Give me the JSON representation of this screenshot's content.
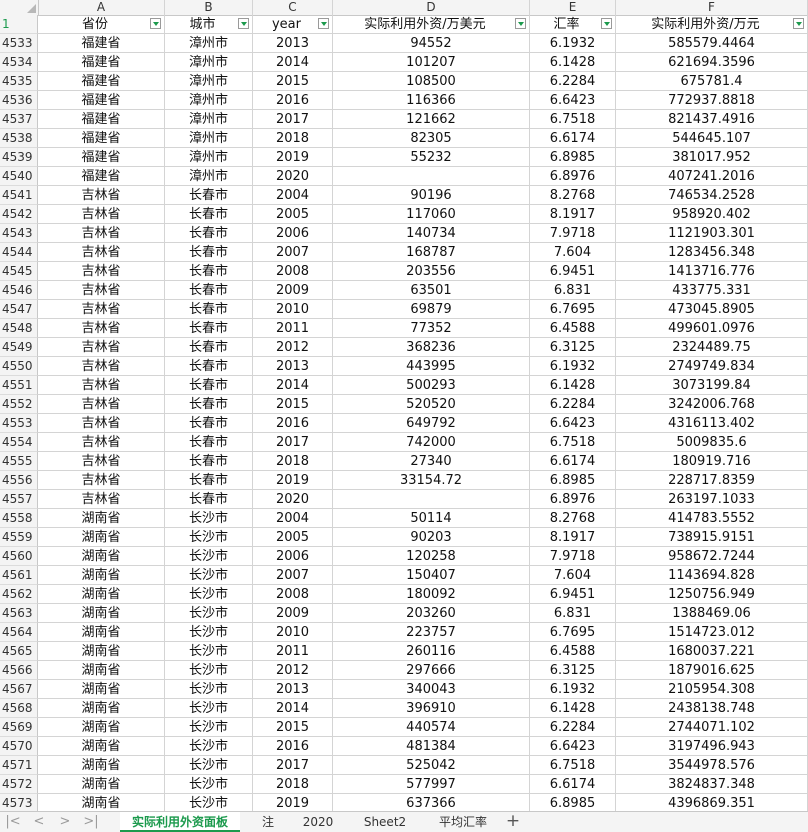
{
  "columns": [
    "A",
    "B",
    "C",
    "D",
    "E",
    "F"
  ],
  "header_row_num": "1",
  "headers": [
    "省份",
    "城市",
    "year",
    "实际利用外资/万美元",
    "汇率",
    "实际利用外资/万元"
  ],
  "rows": [
    [
      "4533",
      "福建省",
      "漳州市",
      "2013",
      "94552",
      "6.1932",
      "585579.4464"
    ],
    [
      "4534",
      "福建省",
      "漳州市",
      "2014",
      "101207",
      "6.1428",
      "621694.3596"
    ],
    [
      "4535",
      "福建省",
      "漳州市",
      "2015",
      "108500",
      "6.2284",
      "675781.4"
    ],
    [
      "4536",
      "福建省",
      "漳州市",
      "2016",
      "116366",
      "6.6423",
      "772937.8818"
    ],
    [
      "4537",
      "福建省",
      "漳州市",
      "2017",
      "121662",
      "6.7518",
      "821437.4916"
    ],
    [
      "4538",
      "福建省",
      "漳州市",
      "2018",
      "82305",
      "6.6174",
      "544645.107"
    ],
    [
      "4539",
      "福建省",
      "漳州市",
      "2019",
      "55232",
      "6.8985",
      "381017.952"
    ],
    [
      "4540",
      "福建省",
      "漳州市",
      "2020",
      "",
      "6.8976",
      "407241.2016"
    ],
    [
      "4541",
      "吉林省",
      "长春市",
      "2004",
      "90196",
      "8.2768",
      "746534.2528"
    ],
    [
      "4542",
      "吉林省",
      "长春市",
      "2005",
      "117060",
      "8.1917",
      "958920.402"
    ],
    [
      "4543",
      "吉林省",
      "长春市",
      "2006",
      "140734",
      "7.9718",
      "1121903.301"
    ],
    [
      "4544",
      "吉林省",
      "长春市",
      "2007",
      "168787",
      "7.604",
      "1283456.348"
    ],
    [
      "4545",
      "吉林省",
      "长春市",
      "2008",
      "203556",
      "6.9451",
      "1413716.776"
    ],
    [
      "4546",
      "吉林省",
      "长春市",
      "2009",
      "63501",
      "6.831",
      "433775.331"
    ],
    [
      "4547",
      "吉林省",
      "长春市",
      "2010",
      "69879",
      "6.7695",
      "473045.8905"
    ],
    [
      "4548",
      "吉林省",
      "长春市",
      "2011",
      "77352",
      "6.4588",
      "499601.0976"
    ],
    [
      "4549",
      "吉林省",
      "长春市",
      "2012",
      "368236",
      "6.3125",
      "2324489.75"
    ],
    [
      "4550",
      "吉林省",
      "长春市",
      "2013",
      "443995",
      "6.1932",
      "2749749.834"
    ],
    [
      "4551",
      "吉林省",
      "长春市",
      "2014",
      "500293",
      "6.1428",
      "3073199.84"
    ],
    [
      "4552",
      "吉林省",
      "长春市",
      "2015",
      "520520",
      "6.2284",
      "3242006.768"
    ],
    [
      "4553",
      "吉林省",
      "长春市",
      "2016",
      "649792",
      "6.6423",
      "4316113.402"
    ],
    [
      "4554",
      "吉林省",
      "长春市",
      "2017",
      "742000",
      "6.7518",
      "5009835.6"
    ],
    [
      "4555",
      "吉林省",
      "长春市",
      "2018",
      "27340",
      "6.6174",
      "180919.716"
    ],
    [
      "4556",
      "吉林省",
      "长春市",
      "2019",
      "33154.72",
      "6.8985",
      "228717.8359"
    ],
    [
      "4557",
      "吉林省",
      "长春市",
      "2020",
      "",
      "6.8976",
      "263197.1033"
    ],
    [
      "4558",
      "湖南省",
      "长沙市",
      "2004",
      "50114",
      "8.2768",
      "414783.5552"
    ],
    [
      "4559",
      "湖南省",
      "长沙市",
      "2005",
      "90203",
      "8.1917",
      "738915.9151"
    ],
    [
      "4560",
      "湖南省",
      "长沙市",
      "2006",
      "120258",
      "7.9718",
      "958672.7244"
    ],
    [
      "4561",
      "湖南省",
      "长沙市",
      "2007",
      "150407",
      "7.604",
      "1143694.828"
    ],
    [
      "4562",
      "湖南省",
      "长沙市",
      "2008",
      "180092",
      "6.9451",
      "1250756.949"
    ],
    [
      "4563",
      "湖南省",
      "长沙市",
      "2009",
      "203260",
      "6.831",
      "1388469.06"
    ],
    [
      "4564",
      "湖南省",
      "长沙市",
      "2010",
      "223757",
      "6.7695",
      "1514723.012"
    ],
    [
      "4565",
      "湖南省",
      "长沙市",
      "2011",
      "260116",
      "6.4588",
      "1680037.221"
    ],
    [
      "4566",
      "湖南省",
      "长沙市",
      "2012",
      "297666",
      "6.3125",
      "1879016.625"
    ],
    [
      "4567",
      "湖南省",
      "长沙市",
      "2013",
      "340043",
      "6.1932",
      "2105954.308"
    ],
    [
      "4568",
      "湖南省",
      "长沙市",
      "2014",
      "396910",
      "6.1428",
      "2438138.748"
    ],
    [
      "4569",
      "湖南省",
      "长沙市",
      "2015",
      "440574",
      "6.2284",
      "2744071.102"
    ],
    [
      "4570",
      "湖南省",
      "长沙市",
      "2016",
      "481384",
      "6.6423",
      "3197496.943"
    ],
    [
      "4571",
      "湖南省",
      "长沙市",
      "2017",
      "525042",
      "6.7518",
      "3544978.576"
    ],
    [
      "4572",
      "湖南省",
      "长沙市",
      "2018",
      "577997",
      "6.6174",
      "3824837.348"
    ],
    [
      "4573",
      "湖南省",
      "长沙市",
      "2019",
      "637366",
      "6.8985",
      "4396869.351"
    ]
  ],
  "sheet_tabs": [
    "实际利用外资面板",
    "注",
    "2020",
    "Sheet2",
    "平均汇率"
  ],
  "active_tab": "实际利用外资面板",
  "nav_icons": [
    "first-sheet-icon",
    "prev-sheet-icon",
    "next-sheet-icon",
    "last-sheet-icon"
  ],
  "nav_glyphs": [
    "|<",
    "<",
    ">",
    ">|"
  ],
  "add_tab_label": "+",
  "accent_color": "#1c9a4d"
}
